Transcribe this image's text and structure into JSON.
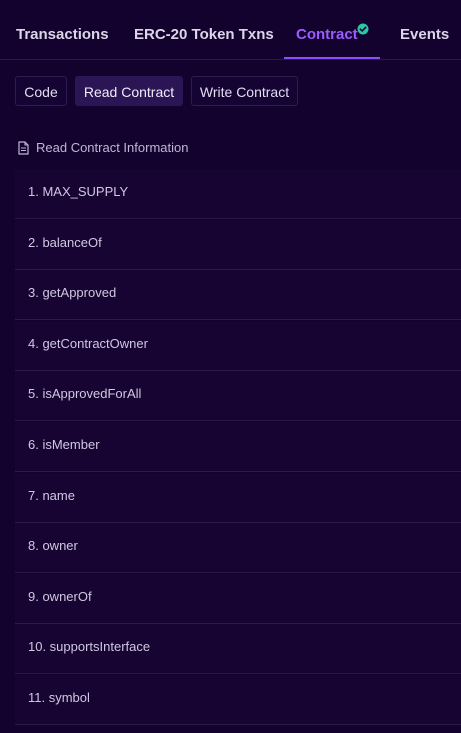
{
  "tabs": [
    {
      "label": "Transactions",
      "active": false
    },
    {
      "label": "ERC-20 Token Txns",
      "active": false
    },
    {
      "label": "Contract",
      "active": true,
      "verified_icon": "check-circle-icon"
    },
    {
      "label": "Events",
      "active": false
    }
  ],
  "subtabs": [
    {
      "label": "Code",
      "active": false
    },
    {
      "label": "Read Contract",
      "active": true
    },
    {
      "label": "Write Contract",
      "active": false
    }
  ],
  "section": {
    "icon": "document-icon",
    "title": "Read Contract Information"
  },
  "functions": [
    "1. MAX_SUPPLY",
    "2. balanceOf",
    "3. getApproved",
    "4. getContractOwner",
    "5. isApprovedForAll",
    "6. isMember",
    "7. name",
    "8. owner",
    "9. ownerOf",
    "10. supportsInterface",
    "11. symbol"
  ],
  "colors": {
    "background": "#13022e",
    "accent": "#8b4dff",
    "verified": "#2ec4a6",
    "row_background": "#180432"
  }
}
